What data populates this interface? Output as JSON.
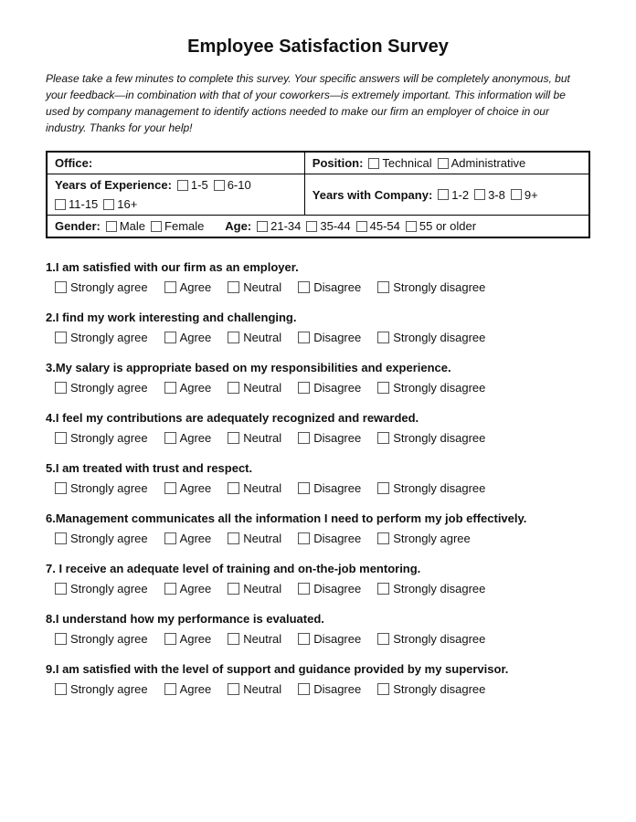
{
  "title": "Employee Satisfaction Survey",
  "intro": "Please take a few minutes to complete this survey. Your specific answers will be completely anonymous, but your feedback—in combination with that of your coworkers—is extremely important. This information will be used by company management to identify actions needed to make our firm an employer of choice in our industry. Thanks for your help!",
  "demographics": {
    "row1": {
      "office_label": "Office:",
      "position_label": "Position:",
      "position_options": [
        "Technical",
        "Administrative"
      ]
    },
    "row2": {
      "years_exp_label": "Years of Experience:",
      "years_exp_options": [
        "1-5",
        "6-10",
        "11-15",
        "16+"
      ],
      "years_company_label": "Years with Company:",
      "years_company_options": [
        "1-2",
        "3-8",
        "9+"
      ]
    },
    "row3": {
      "gender_label": "Gender:",
      "gender_options": [
        "Male",
        "Female"
      ],
      "age_label": "Age:",
      "age_options": [
        "21-34",
        "35-44",
        "45-54",
        "55 or older"
      ]
    }
  },
  "questions": [
    {
      "number": "1",
      "text": "I am satisfied with our firm as an employer.",
      "options": [
        "Strongly agree",
        "Agree",
        "Neutral",
        "Disagree",
        "Strongly disagree"
      ]
    },
    {
      "number": "2",
      "text": "I find my work interesting and challenging.",
      "options": [
        "Strongly agree",
        "Agree",
        "Neutral",
        "Disagree",
        "Strongly disagree"
      ]
    },
    {
      "number": "3",
      "text": "My salary is appropriate based on my responsibilities and experience.",
      "options": [
        "Strongly agree",
        "Agree",
        "Neutral",
        "Disagree",
        "Strongly disagree"
      ]
    },
    {
      "number": "4",
      "text": "I feel my contributions are adequately recognized and rewarded.",
      "options": [
        "Strongly agree",
        "Agree",
        "Neutral",
        "Disagree",
        "Strongly disagree"
      ]
    },
    {
      "number": "5",
      "text": "I am treated with trust and respect.",
      "options": [
        "Strongly agree",
        "Agree",
        "Neutral",
        "Disagree",
        "Strongly disagree"
      ]
    },
    {
      "number": "6",
      "text": "Management communicates all the information I need to perform my job effectively.",
      "options": [
        "Strongly agree",
        "Agree",
        "Neutral",
        "Disagree",
        "Strongly agree"
      ]
    },
    {
      "number": "7",
      "text": " I receive an adequate level of training and on-the-job mentoring.",
      "options": [
        "Strongly agree",
        "Agree",
        "Neutral",
        "Disagree",
        "Strongly disagree"
      ]
    },
    {
      "number": "8",
      "text": "I understand how my performance is evaluated.",
      "options": [
        "Strongly agree",
        "Agree",
        "Neutral",
        "Disagree",
        "Strongly disagree"
      ]
    },
    {
      "number": "9",
      "text": "I am satisfied with the level of support and guidance provided by my supervisor.",
      "options": [
        "Strongly agree",
        "Agree",
        "Neutral",
        "Disagree",
        "Strongly disagree"
      ]
    }
  ]
}
